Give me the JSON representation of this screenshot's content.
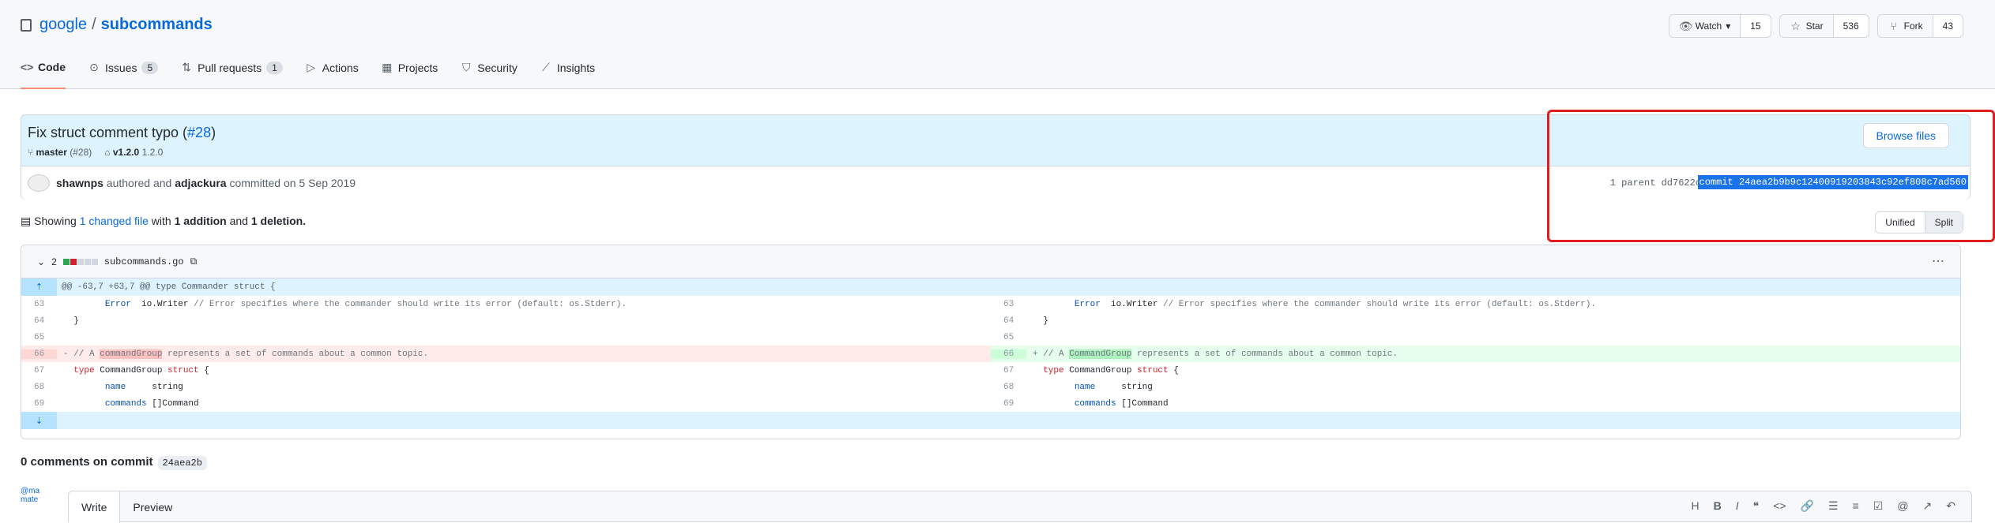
{
  "repo": {
    "owner": "google",
    "sep": "/",
    "name": "subcommands"
  },
  "header_actions": [
    {
      "label": "Watch",
      "count": "15",
      "icon": "eye-icon"
    },
    {
      "label": "Star",
      "count": "536",
      "icon": "star-icon"
    },
    {
      "label": "Fork",
      "count": "43",
      "icon": "fork-icon"
    }
  ],
  "tabs": [
    {
      "label": "Code",
      "icon": "code-icon",
      "count": ""
    },
    {
      "label": "Issues",
      "icon": "issue-icon",
      "count": "5"
    },
    {
      "label": "Pull requests",
      "icon": "pr-icon",
      "count": "1"
    },
    {
      "label": "Actions",
      "icon": "play-icon",
      "count": ""
    },
    {
      "label": "Projects",
      "icon": "project-icon",
      "count": ""
    },
    {
      "label": "Security",
      "icon": "shield-icon",
      "count": ""
    },
    {
      "label": "Insights",
      "icon": "graph-icon",
      "count": ""
    }
  ],
  "commit": {
    "title": "Fix struct comment typo (",
    "pr_link": "#28",
    "title_end": ")",
    "branch": "master",
    "branch_pr": "(#28)",
    "tag": "v1.2.0",
    "tag2": "1.2.0",
    "browse_label": "Browse files",
    "author": "shawnps",
    "authored": "authored and",
    "committer": "adjackura",
    "committed": "committed on 5 Sep 2019",
    "parent": "1 parent dd7622c",
    "sha": "commit 24aea2b9b9c12400919203843c92ef808c7ad560"
  },
  "summary": {
    "prefix": "Showing",
    "changed": "1 changed file",
    "with": "with",
    "additions": "1 addition",
    "and": "and",
    "deletions": "1 deletion."
  },
  "view": {
    "unified": "Unified",
    "split": "Split"
  },
  "file": {
    "count": "2",
    "name": "subcommands.go",
    "hunk": "@@ -63,7 +63,7 @@ type Commander struct {"
  },
  "comments": {
    "label": "0 comments on commit",
    "sha": "24aea2b"
  },
  "editor": {
    "write": "Write",
    "preview": "Preview",
    "avatar_alt": "@ma mate"
  }
}
